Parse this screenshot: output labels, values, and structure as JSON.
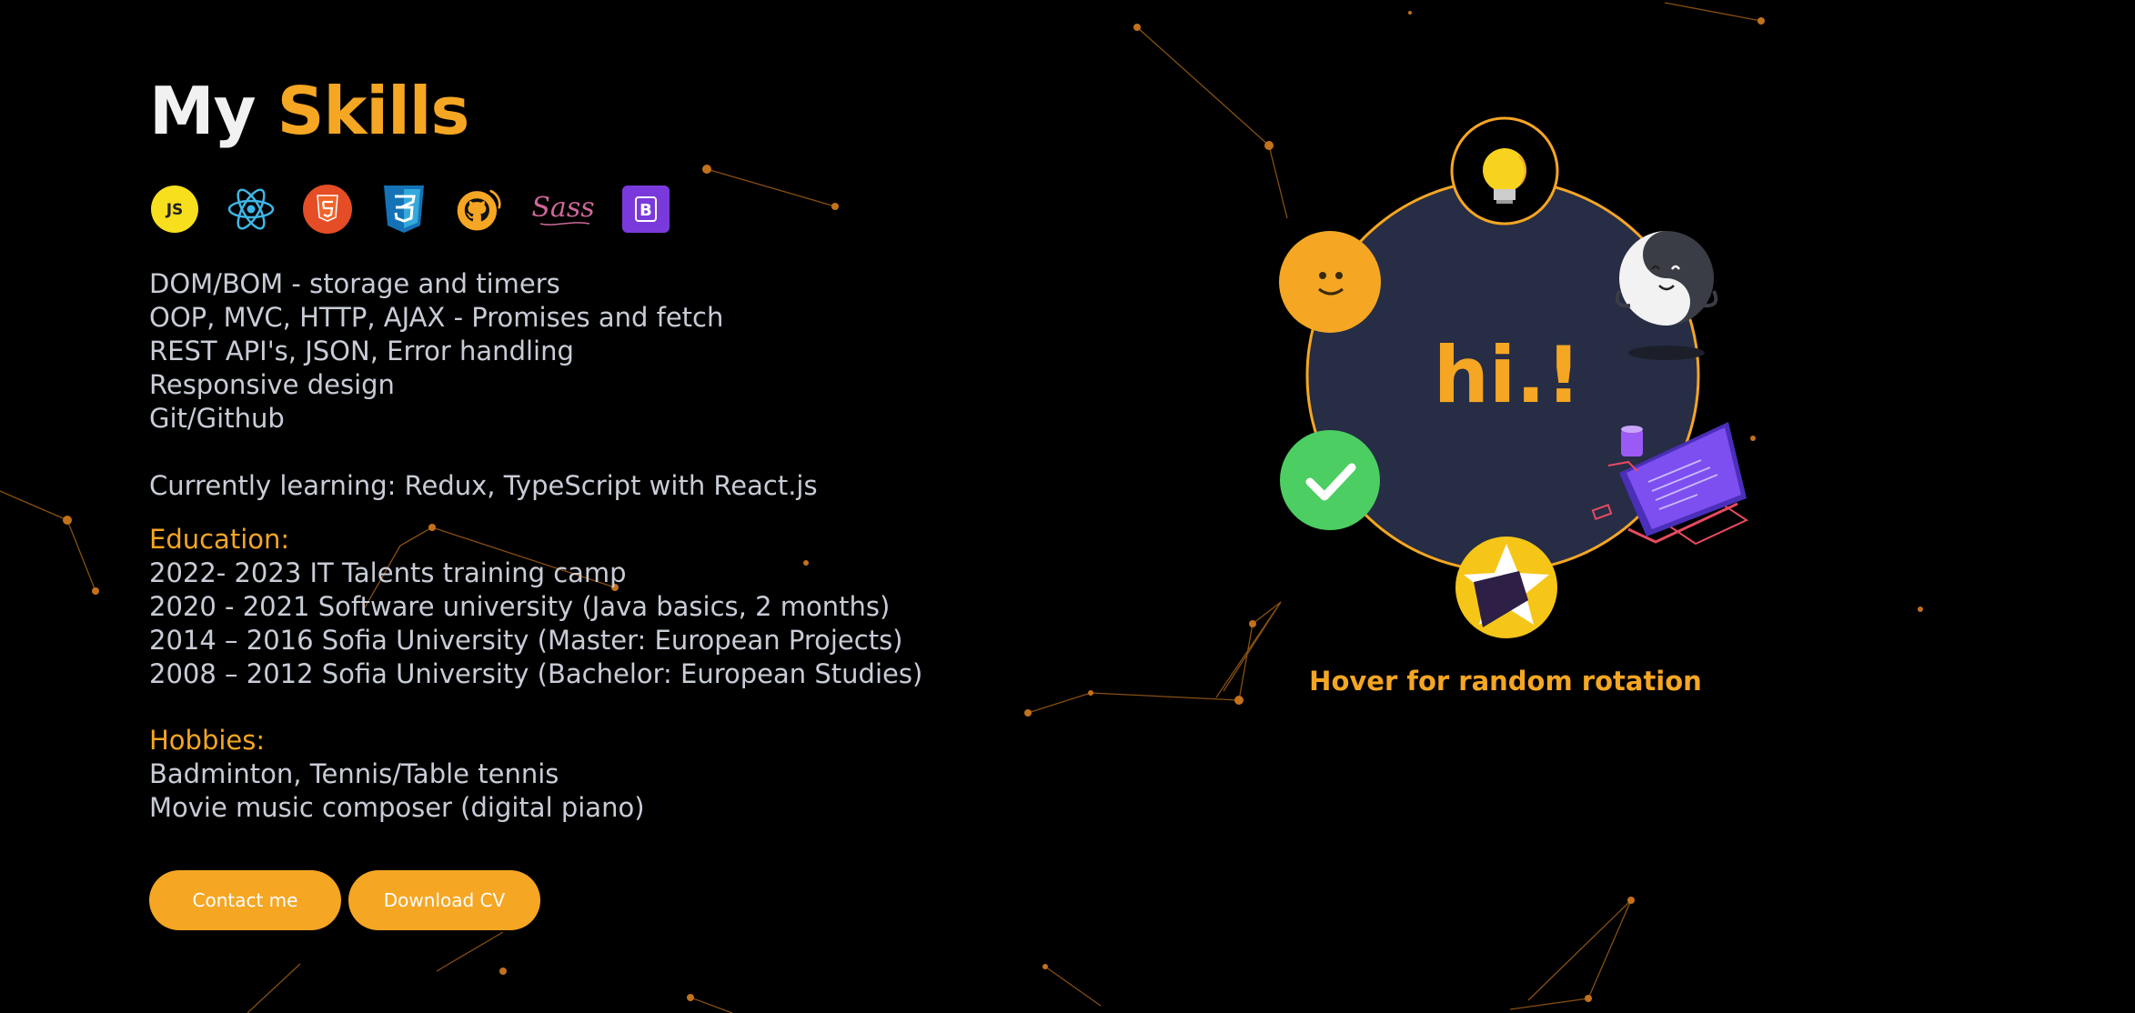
{
  "title": {
    "first": "My",
    "second": "Skills"
  },
  "tech_icons": [
    "js-icon",
    "react-icon",
    "html5-icon",
    "css3-icon",
    "github-icon",
    "sass-icon",
    "bootstrap-icon"
  ],
  "icon_labels": {
    "js": "JS",
    "bootstrap": "B",
    "sass": "Sass"
  },
  "skills": [
    "DOM/BOM - storage and timers",
    "OOP, MVC, HTTP, AJAX - Promises and fetch",
    "REST API's, JSON, Error handling",
    "Responsive design",
    "Git/Github"
  ],
  "learning": "Currently learning: Redux, TypeScript with React.js",
  "education": {
    "heading": "Education:",
    "items": [
      "2022- 2023 IT Talents training camp",
      "2020 - 2021 Software university (Java basics, 2 months)",
      "2014 – 2016 Sofia University (Master: European Projects)",
      "2008 – 2012 Sofia University (Bachelor: European Studies)"
    ]
  },
  "hobbies": {
    "heading": "Hobbies:",
    "items": [
      "Badminton, Tennis/Table tennis",
      "Movie music composer (digital piano)"
    ]
  },
  "buttons": {
    "contact": "Contact me",
    "download": "Download CV"
  },
  "circle": {
    "center_text": "hi.!",
    "hover_text": "Hover for random rotation"
  },
  "colors": {
    "accent": "#f5a623",
    "background": "#000000",
    "circle_fill": "#262d45",
    "text": "#c8ccd6",
    "check": "#4cce62"
  }
}
